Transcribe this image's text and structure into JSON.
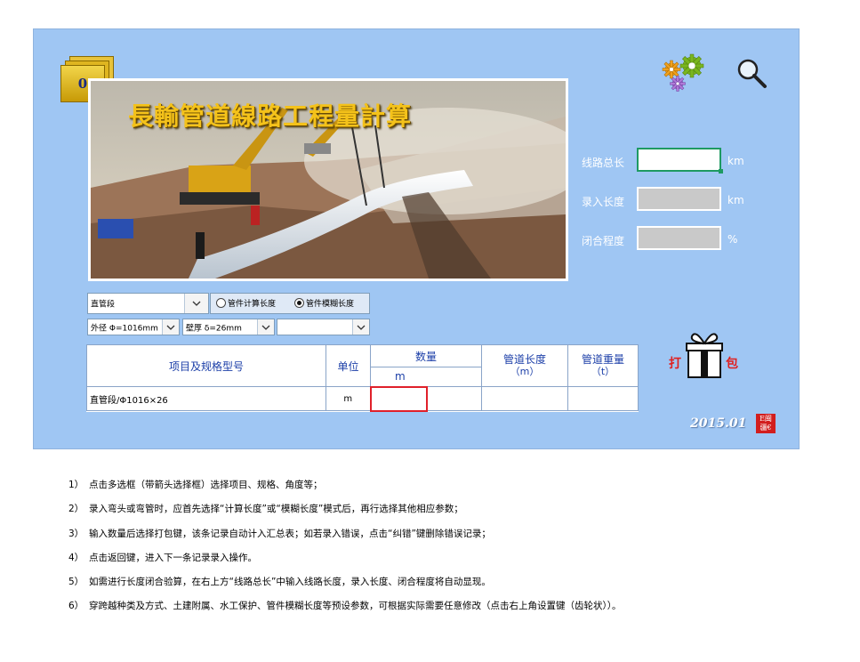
{
  "badge": {
    "count": "0"
  },
  "banner": {
    "title": "長輸管道線路工程量計算"
  },
  "summary": {
    "fields": [
      {
        "label": "线路总长",
        "value": "",
        "unit": "km"
      },
      {
        "label": "录入长度",
        "value": "",
        "unit": "km"
      },
      {
        "label": "闭合程度",
        "value": "",
        "unit": "%"
      }
    ]
  },
  "selectors": {
    "item": {
      "selected": "直管段"
    },
    "mode": {
      "options": [
        "管件计算长度",
        "管件模糊长度"
      ],
      "selected_index": 1
    },
    "diameter": {
      "selected": "外径 Φ=1016mm"
    },
    "thickness": {
      "selected": "壁厚 δ=26mm"
    },
    "extra": {
      "selected": ""
    }
  },
  "table": {
    "headers": {
      "item": "项目及规格型号",
      "unit": "单位",
      "quantity": "数量",
      "quantity_unit": "m",
      "length": "管道长度",
      "length_unit": "（m）",
      "weight": "管道重量",
      "weight_unit": "（t）"
    },
    "row": {
      "item": "直管段/Φ1016×26",
      "unit": "m",
      "quantity": "",
      "quantity2": "",
      "length": "",
      "weight": ""
    }
  },
  "pack": {
    "left": "打",
    "right": "包"
  },
  "footer": {
    "date": "2015.01",
    "logo_top": "E闽",
    "logo_bottom": "疆€"
  },
  "notes": [
    {
      "n": "1）",
      "text": "点击多选框（带箭头选择框）选择项目、规格、角度等；"
    },
    {
      "n": "2）",
      "text": "录入弯头或弯管时，应首先选择“计算长度”或“模糊长度”模式后，再行选择其他相应参数；"
    },
    {
      "n": "3）",
      "text": "输入数量后选择打包键，该条记录自动计入汇总表；如若录入错误，点击“纠错”键删除错误记录；"
    },
    {
      "n": "4）",
      "text": "点击返回键，进入下一条记录录入操作。"
    },
    {
      "n": "5）",
      "text": "如需进行长度闭合验算，在右上方“线路总长”中输入线路长度，录入长度、闭合程度将自动显现。"
    },
    {
      "n": "6）",
      "text": "穿跨越种类及方式、土建附属、水工保护、管件模糊长度等预设参数，可根据实际需要任意修改（点击右上角设置键（齿轮状））。"
    }
  ],
  "colors": {
    "panel": "#9fc6f3",
    "accent_red": "#e0202a",
    "active_border": "#1e9a62",
    "header_text": "#1c3fa8"
  }
}
